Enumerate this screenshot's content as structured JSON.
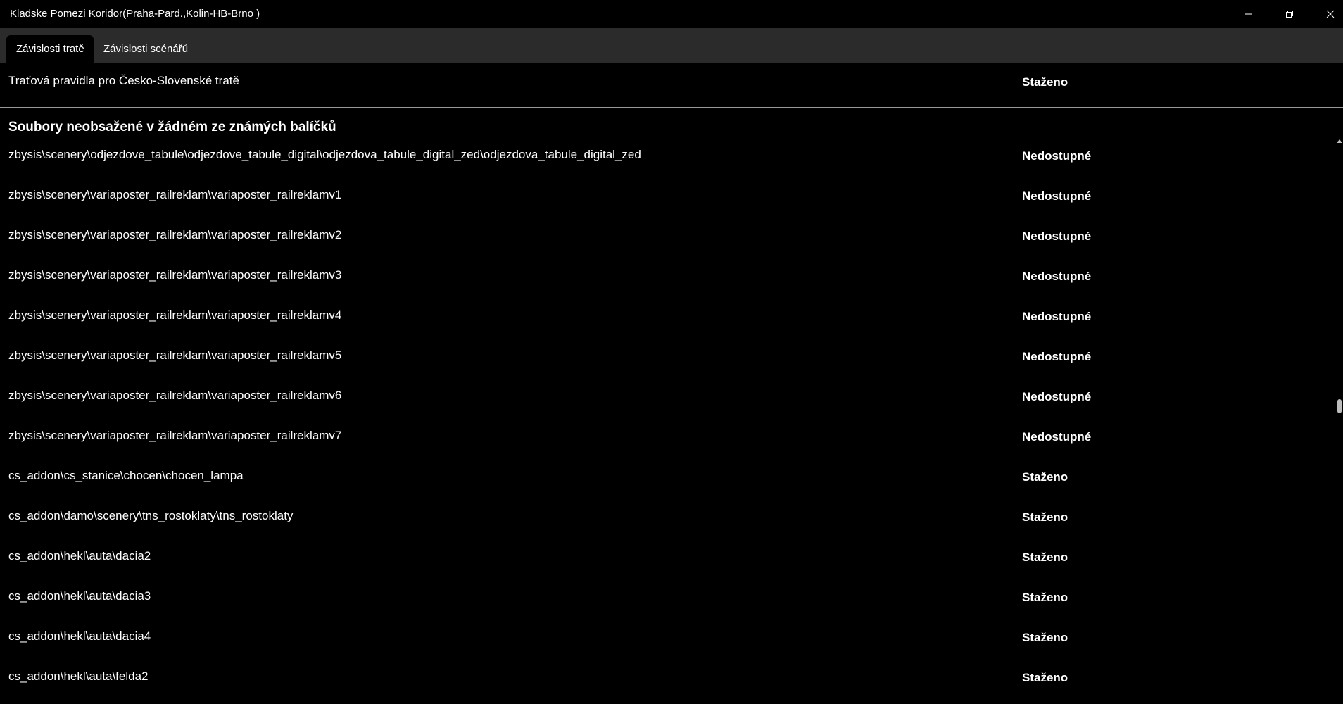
{
  "window": {
    "title": "Kladske Pomezi Koridor(Praha-Pard.,Kolin-HB-Brno )"
  },
  "tabs": [
    {
      "label": "Závislosti tratě"
    },
    {
      "label": "Závislosti scénářů"
    }
  ],
  "top_row": {
    "name": "Traťová pravidla pro Česko-Slovenské tratě",
    "status": "Staženo"
  },
  "section": {
    "heading": "Soubory neobsažené v žádném ze známých balíčků",
    "items": [
      {
        "path": "zbysis\\scenery\\odjezdove_tabule\\odjezdove_tabule_digital\\odjezdova_tabule_digital_zed\\odjezdova_tabule_digital_zed",
        "status": "Nedostupné"
      },
      {
        "path": "zbysis\\scenery\\variaposter_railreklam\\variaposter_railreklamv1",
        "status": "Nedostupné"
      },
      {
        "path": "zbysis\\scenery\\variaposter_railreklam\\variaposter_railreklamv2",
        "status": "Nedostupné"
      },
      {
        "path": "zbysis\\scenery\\variaposter_railreklam\\variaposter_railreklamv3",
        "status": "Nedostupné"
      },
      {
        "path": "zbysis\\scenery\\variaposter_railreklam\\variaposter_railreklamv4",
        "status": "Nedostupné"
      },
      {
        "path": "zbysis\\scenery\\variaposter_railreklam\\variaposter_railreklamv5",
        "status": "Nedostupné"
      },
      {
        "path": "zbysis\\scenery\\variaposter_railreklam\\variaposter_railreklamv6",
        "status": "Nedostupné"
      },
      {
        "path": "zbysis\\scenery\\variaposter_railreklam\\variaposter_railreklamv7",
        "status": "Nedostupné"
      },
      {
        "path": "cs_addon\\cs_stanice\\chocen\\chocen_lampa",
        "status": "Staženo"
      },
      {
        "path": "cs_addon\\damo\\scenery\\tns_rostoklaty\\tns_rostoklaty",
        "status": "Staženo"
      },
      {
        "path": "cs_addon\\hekl\\auta\\dacia2",
        "status": "Staženo"
      },
      {
        "path": "cs_addon\\hekl\\auta\\dacia3",
        "status": "Staženo"
      },
      {
        "path": "cs_addon\\hekl\\auta\\dacia4",
        "status": "Staženo"
      },
      {
        "path": "cs_addon\\hekl\\auta\\felda2",
        "status": "Staženo"
      }
    ]
  },
  "colors": {
    "background": "#000000",
    "tabbar": "#2b2b2b",
    "text": "#ffffff",
    "divider": "#9a9a9a"
  },
  "icons": {
    "minimize": "minimize-icon",
    "restore": "restore-icon",
    "close": "close-icon"
  }
}
